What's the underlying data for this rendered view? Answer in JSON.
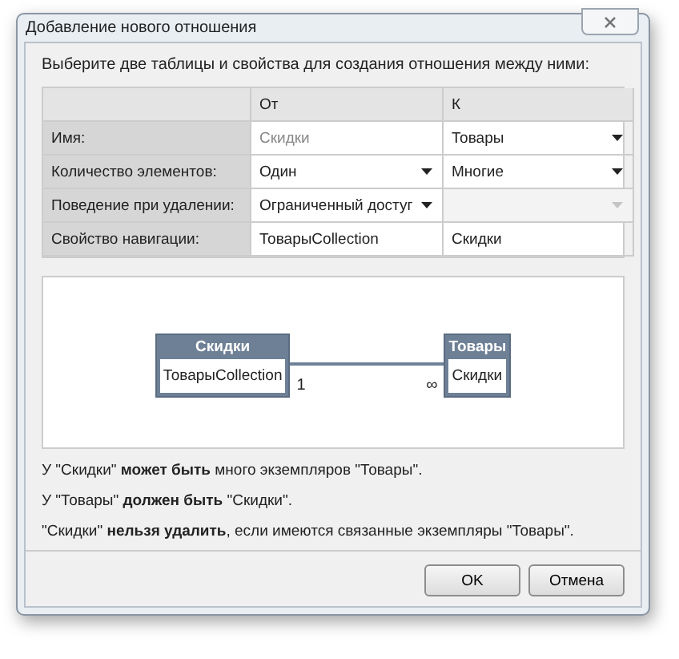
{
  "window": {
    "title": "Добавление нового отношения"
  },
  "instruction": "Выберите две таблицы и свойства для создания отношения между ними:",
  "table": {
    "columns": [
      "От",
      "К"
    ],
    "rows": [
      {
        "label": "Имя:",
        "cells": [
          {
            "kind": "readonly",
            "value": "Скидки"
          },
          {
            "kind": "dropdown",
            "value": "Товары",
            "disabled": false
          }
        ]
      },
      {
        "label": "Количество элементов:",
        "cells": [
          {
            "kind": "dropdown",
            "value": "Один",
            "disabled": false
          },
          {
            "kind": "dropdown",
            "value": "Многие",
            "disabled": false
          }
        ]
      },
      {
        "label": "Поведение при удалении:",
        "cells": [
          {
            "kind": "dropdown",
            "value": "Ограниченный достуг",
            "disabled": false
          },
          {
            "kind": "dropdown",
            "disabled": true
          }
        ]
      },
      {
        "label": "Свойство навигации:",
        "cells": [
          {
            "kind": "input",
            "value": "ТоварыCollection"
          },
          {
            "kind": "input",
            "value": "Скидки"
          }
        ]
      }
    ]
  },
  "diagram": {
    "left": {
      "title": "Скидки",
      "property": "ТоварыCollection",
      "multiplicity": "1"
    },
    "right": {
      "title": "Товары",
      "property": "Скидки",
      "multiplicity": "∞"
    }
  },
  "descriptions": [
    "У \"Скидки\" **может быть** много экземпляров \"Товары\".",
    "У \"Товары\" **должен быть** \"Скидки\".",
    "\"Скидки\" **нельзя удалить**, если имеются связанные экземпляры \"Товары\"."
  ],
  "buttons": [
    "OK",
    "Отмена"
  ]
}
